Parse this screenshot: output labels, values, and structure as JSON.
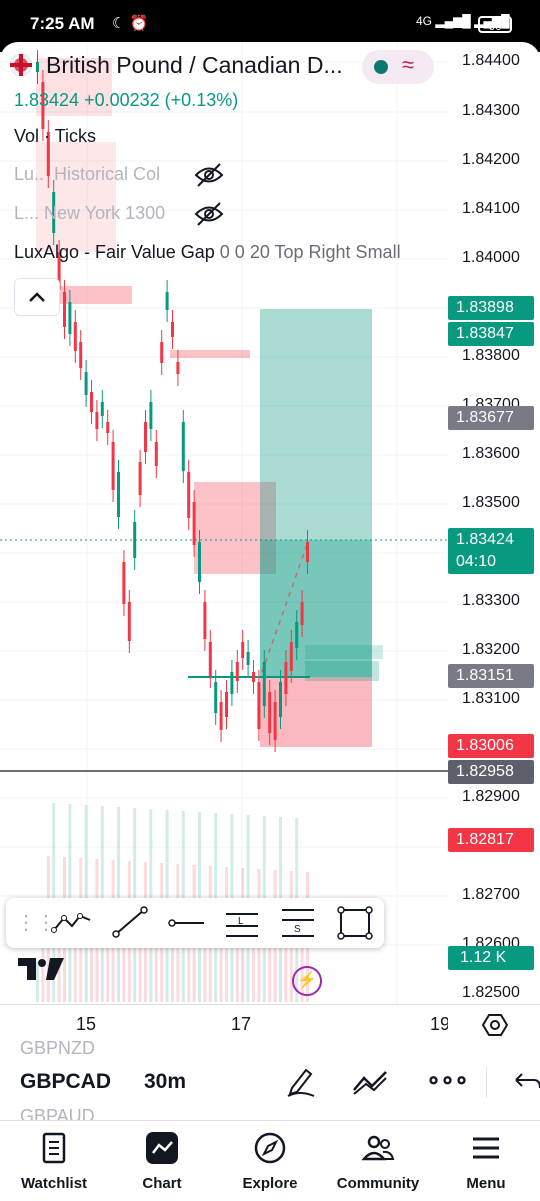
{
  "status_bar": {
    "time": "7:25 AM",
    "network": "4G",
    "battery": "60"
  },
  "header": {
    "title": "British Pound / Canadian D...",
    "price": "1.83424",
    "change": "+0.00232 (+0.13%)"
  },
  "legend": {
    "vol": "Vol · Ticks",
    "ind1_short": "Lu..",
    "ind1_name": "Historical Col",
    "ind2_short": "L...",
    "ind2_name": "New York 1300",
    "ind3": "LuxAlgo - Fair Value Gap",
    "ind3_params": "0 0 20 Top Right Small"
  },
  "price_axis": {
    "ticks": [
      "1.84400",
      "1.84300",
      "1.84200",
      "1.84100",
      "1.84000",
      "1.83800",
      "1.83700",
      "1.83600",
      "1.83500",
      "1.83300",
      "1.83200",
      "1.83100",
      "1.82900",
      "1.82700",
      "1.82600",
      "1.82500"
    ],
    "labels": {
      "tp": "1.83898",
      "entry_hi": "1.83847",
      "grey_hi": "1.83677",
      "last": "1.83424",
      "countdown": "04:10",
      "grey_mid": "1.83151",
      "stop": "1.83006",
      "grey_low": "1.82958",
      "red_low": "1.82817",
      "volume": "1.12 K"
    }
  },
  "time_axis": {
    "labels": [
      "15",
      "17",
      "19"
    ]
  },
  "drawing_toolbar": {
    "items": [
      "trend-path",
      "trend-line",
      "horizontal-ray",
      "long-position",
      "short-position",
      "rectangle"
    ]
  },
  "symbol_bar": {
    "prev_symbol": "GBPNZD",
    "symbol": "GBPCAD",
    "next_symbol": "GBPAUD",
    "interval": "30m"
  },
  "nav": {
    "watchlist": "Watchlist",
    "chart": "Chart",
    "explore": "Explore",
    "community": "Community",
    "menu": "Menu"
  },
  "colors": {
    "up": "#089981",
    "down": "#f23645",
    "accent": "#9c27b0"
  }
}
